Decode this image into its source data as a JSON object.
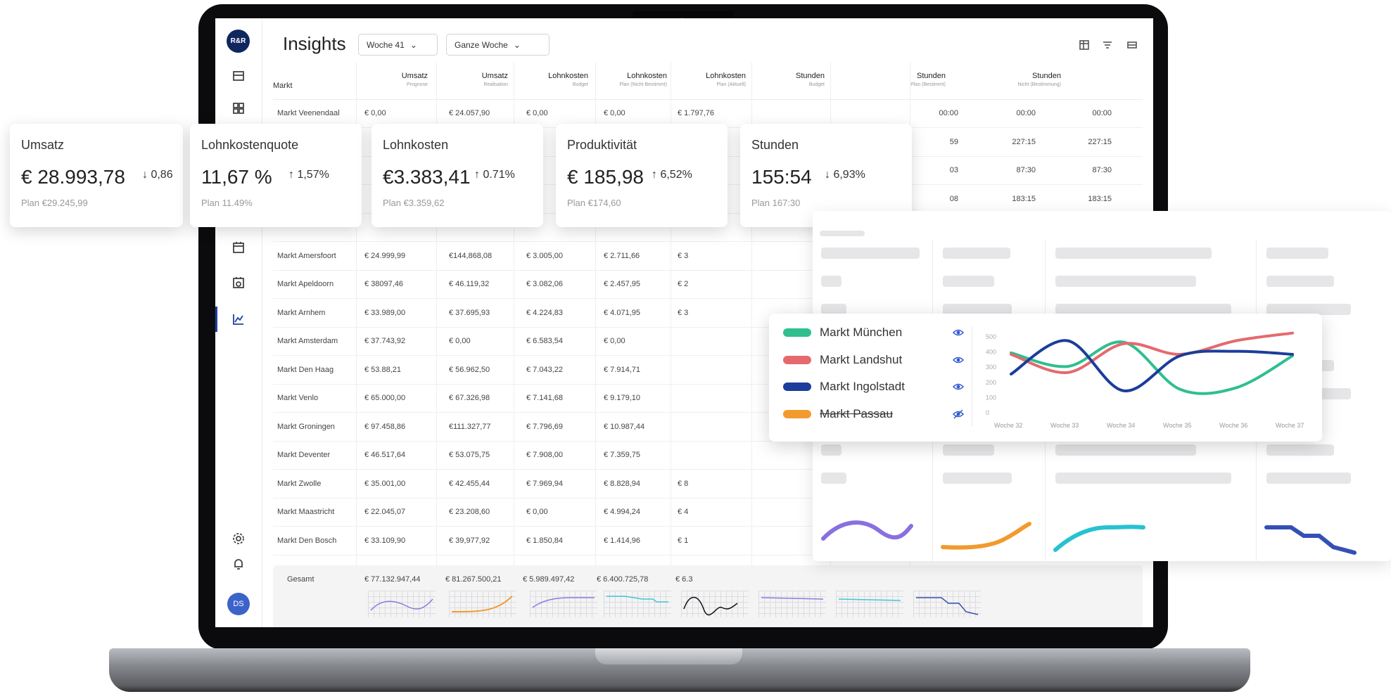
{
  "app": {
    "logo": "R&R",
    "title": "Insights",
    "week_select": "Woche 41",
    "range_select": "Ganze Woche",
    "user_initials": "DS"
  },
  "icons": {
    "sidebar": [
      "store-icon",
      "dashboard-icon",
      "calendar-icon",
      "team-calendar-icon",
      "chart-line-icon",
      "settings-icon",
      "bell-icon"
    ],
    "toolbar": [
      "table-settings-icon",
      "filter-icon",
      "layout-icon"
    ]
  },
  "table": {
    "columns": [
      {
        "label": "Markt",
        "sub": ""
      },
      {
        "label": "Umsatz",
        "sub": "Prognose"
      },
      {
        "label": "Umsatz",
        "sub": "Realisation"
      },
      {
        "label": "Lohnkosten",
        "sub": "Budget"
      },
      {
        "label": "Lohnkosten",
        "sub": "Plan (Nicht Bestimmt)"
      },
      {
        "label": "Lohnkosten",
        "sub": "Plan (Aktuell)"
      },
      {
        "label": "Stunden",
        "sub": "Budget"
      },
      {
        "label": "Stunden",
        "sub": "Plan (Bestimmt)"
      },
      {
        "label": "Stunden",
        "sub": "Nicht (Bestimmung)"
      }
    ],
    "rows": [
      {
        "name": "Markt Veenendaal",
        "c1": "0,00",
        "c2": "€ 24.057,90",
        "c3": "0,00",
        "c4": "0,00",
        "c5": "€ 1.797,76",
        "c6": "00:00",
        "c7": "00:00",
        "c8": "00:00"
      },
      {
        "name": "",
        "c1": "",
        "c2": "",
        "c3": "",
        "c4": "",
        "c5": "",
        "c6": "59",
        "c7": "227:15",
        "c8": "227:15"
      },
      {
        "name": "",
        "c1": "",
        "c2": "",
        "c3": "",
        "c4": "",
        "c5": "",
        "c6": "03",
        "c7": "87:30",
        "c8": "87:30"
      },
      {
        "name": "",
        "c1": "",
        "c2": "",
        "c3": "",
        "c4": "",
        "c5": "",
        "c6": "08",
        "c7": "183:15",
        "c8": "183:15"
      },
      {
        "name": "",
        "c1": "",
        "c2": "",
        "c3": "",
        "c4": "",
        "c5": "",
        "c6": "",
        "c7": "",
        "c8": ""
      },
      {
        "name": "Markt Amersfoort",
        "c1": "€ 24.999,99",
        "c2": "€144,868,08",
        "c3": "3.005,00",
        "c4": "2.711,66",
        "c5": "€ 3",
        "c6": "",
        "c7": "",
        "c8": ""
      },
      {
        "name": "Markt Apeldoorn",
        "c1": "€ 38097,46",
        "c2": "€ 46.119,32",
        "c3": "3.082,06",
        "c4": "2.457,95",
        "c5": "€ 2",
        "c6": "",
        "c7": "",
        "c8": ""
      },
      {
        "name": "Markt Arnhem",
        "c1": "€ 33.989,00",
        "c2": "€ 37.695,93",
        "c3": "4.224,83",
        "c4": "4.071,95",
        "c5": "€ 3",
        "c6": "",
        "c7": "",
        "c8": ""
      },
      {
        "name": "Markt Amsterdam",
        "c1": "€ 37.743,92",
        "c2": "0,00",
        "c3": "6.583,54",
        "c4": "0,00",
        "c5": "",
        "c6": "",
        "c7": "",
        "c8": ""
      },
      {
        "name": "Markt Den Haag",
        "c1": "53.88,21",
        "c2": "€ 56.962,50",
        "c3": "7.043,22",
        "c4": "7.914,71",
        "c5": "",
        "c6": "",
        "c7": "",
        "c8": ""
      },
      {
        "name": "Markt Venlo",
        "c1": "€ 65.000,00",
        "c2": "€ 67.326,98",
        "c3": "7.141,68",
        "c4": "9.179,10",
        "c5": "",
        "c6": "",
        "c7": "",
        "c8": ""
      },
      {
        "name": "Markt Groningen",
        "c1": "€ 97.458,86",
        "c2": "€111.327,77",
        "c3": "7.796,69",
        "c4": "€ 10.987,44",
        "c5": "",
        "c6": "",
        "c7": "",
        "c8": ""
      },
      {
        "name": "Markt Deventer",
        "c1": "€ 46.517,64",
        "c2": "€ 53.075,75",
        "c3": "7.908,00",
        "c4": "7.359,75",
        "c5": "",
        "c6": "",
        "c7": "",
        "c8": ""
      },
      {
        "name": "Markt Zwolle",
        "c1": "€ 35.001,00",
        "c2": "€ 42.455,44",
        "c3": "7.969,94",
        "c4": "8.828,94",
        "c5": "€ 8",
        "c6": "",
        "c7": "",
        "c8": ""
      },
      {
        "name": "Markt Maastricht",
        "c1": "€ 22.045,07",
        "c2": "€ 23.208,60",
        "c3": "0,00",
        "c4": "4.994,24",
        "c5": "€ 4",
        "c6": "",
        "c7": "",
        "c8": ""
      },
      {
        "name": "Markt Den Bosch",
        "c1": "€ 33.109,90",
        "c2": "€ 39,977,92",
        "c3": "1.850,84",
        "c4": "1.414,96",
        "c5": "€ 1",
        "c6": "",
        "c7": "",
        "c8": ""
      }
    ],
    "totals": {
      "label": "Gesamt",
      "c1": "€ 77.132.947,44",
      "c2": "€ 81.267.500,21",
      "c3": "€ 5.989.497,42",
      "c4": "€ 6.400.725,78",
      "c5": "€ 6.3"
    }
  },
  "kpis": [
    {
      "title": "Umsatz",
      "value": "€ 28.993,78",
      "delta": "0,86",
      "dir": "down",
      "plan": "Plan €29.245,99"
    },
    {
      "title": "Lohnkostenquote",
      "value": "11,67 %",
      "delta": "1,57%",
      "dir": "up",
      "plan": "Plan 11.49%"
    },
    {
      "title": "Lohnkosten",
      "value": "€3.383,41",
      "delta": "0.71%",
      "dir": "up",
      "plan": "Plan €3.359,62"
    },
    {
      "title": "Produktivität",
      "value": "€ 185,98",
      "delta": "6,52%",
      "dir": "up",
      "plan": "Plan €174,60"
    },
    {
      "title": "Stunden",
      "value": "155:54",
      "delta": "6,93%",
      "dir": "down",
      "plan": "Plan 167:30"
    }
  ],
  "chart_data": {
    "type": "line",
    "x": [
      "Woche 32",
      "Woche 33",
      "Woche 34",
      "Woche 35",
      "Woche 36",
      "Woche 37"
    ],
    "ylim": [
      0,
      500
    ],
    "yticks": [
      "500",
      "400",
      "300",
      "200",
      "100",
      "0"
    ],
    "series": [
      {
        "name": "Markt München",
        "color": "#2fbf8f",
        "visible": true,
        "values": [
          390,
          300,
          460,
          150,
          160,
          370
        ]
      },
      {
        "name": "Markt Landshut",
        "color": "#e46a6e",
        "visible": true,
        "values": [
          380,
          260,
          450,
          380,
          470,
          520
        ]
      },
      {
        "name": "Markt Ingolstadt",
        "color": "#1b3d9b",
        "visible": true,
        "values": [
          250,
          470,
          140,
          370,
          400,
          380
        ]
      },
      {
        "name": "Markt Passau",
        "color": "#f29a2e",
        "visible": false,
        "values": []
      }
    ]
  }
}
